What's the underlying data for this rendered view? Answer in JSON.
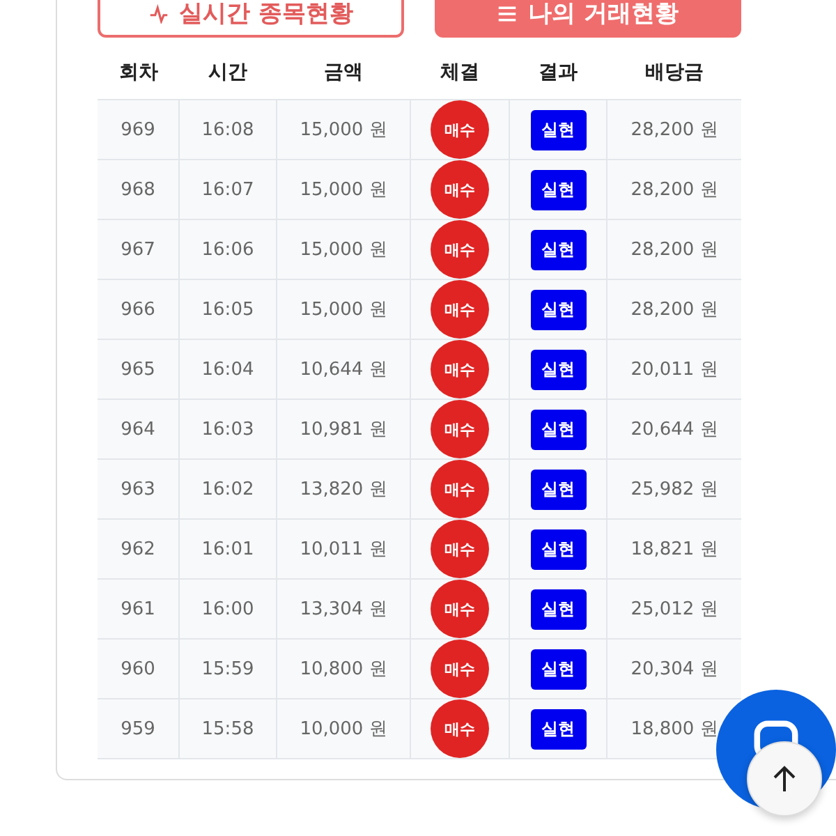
{
  "tabs": [
    {
      "label": "실시간 종목현황",
      "selected": false
    },
    {
      "label": "나의 거래현황",
      "selected": true
    }
  ],
  "table": {
    "columns": [
      "회차",
      "시간",
      "금액",
      "체결",
      "결과",
      "배당금"
    ],
    "rows": [
      {
        "round": "969",
        "time": "16:08",
        "amount": "15,000 원",
        "trade": "매수",
        "result": "실현",
        "payout": "28,200 원"
      },
      {
        "round": "968",
        "time": "16:07",
        "amount": "15,000 원",
        "trade": "매수",
        "result": "실현",
        "payout": "28,200 원"
      },
      {
        "round": "967",
        "time": "16:06",
        "amount": "15,000 원",
        "trade": "매수",
        "result": "실현",
        "payout": "28,200 원"
      },
      {
        "round": "966",
        "time": "16:05",
        "amount": "15,000 원",
        "trade": "매수",
        "result": "실현",
        "payout": "28,200 원"
      },
      {
        "round": "965",
        "time": "16:04",
        "amount": "10,644 원",
        "trade": "매수",
        "result": "실현",
        "payout": "20,011 원"
      },
      {
        "round": "964",
        "time": "16:03",
        "amount": "10,981 원",
        "trade": "매수",
        "result": "실현",
        "payout": "20,644 원"
      },
      {
        "round": "963",
        "time": "16:02",
        "amount": "13,820 원",
        "trade": "매수",
        "result": "실현",
        "payout": "25,982 원"
      },
      {
        "round": "962",
        "time": "16:01",
        "amount": "10,011 원",
        "trade": "매수",
        "result": "실현",
        "payout": "18,821 원"
      },
      {
        "round": "961",
        "time": "16:00",
        "amount": "13,304 원",
        "trade": "매수",
        "result": "실현",
        "payout": "25,012 원"
      },
      {
        "round": "960",
        "time": "15:59",
        "amount": "10,800 원",
        "trade": "매수",
        "result": "실현",
        "payout": "20,304 원"
      },
      {
        "round": "959",
        "time": "15:58",
        "amount": "10,000 원",
        "trade": "매수",
        "result": "실현",
        "payout": "18,800 원"
      }
    ]
  }
}
